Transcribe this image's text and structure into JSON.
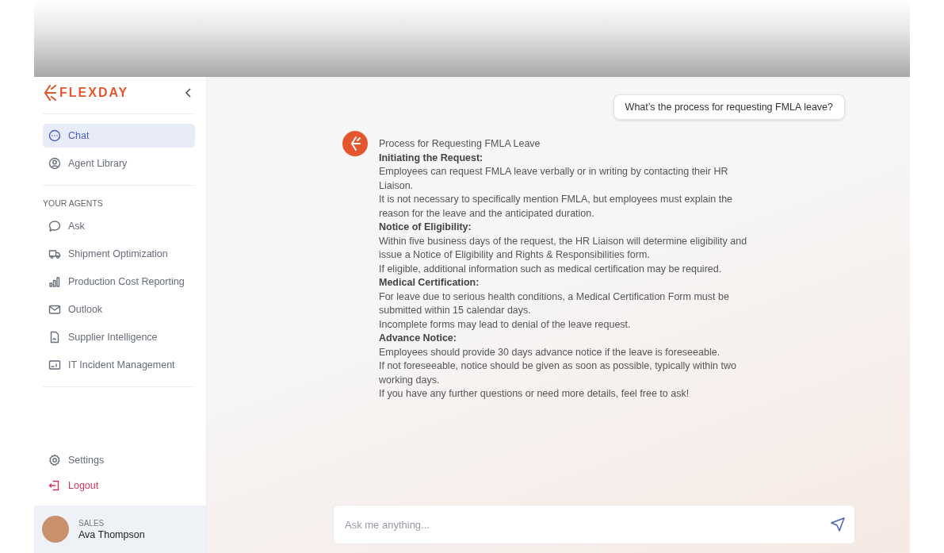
{
  "sidebar": {
    "logo": "FLEXDAY",
    "nav": [
      {
        "label": "Chat",
        "selected": true
      },
      {
        "label": "Agent Library",
        "selected": false
      }
    ],
    "section_label": "YOUR AGENTS",
    "agents": [
      {
        "label": "Ask",
        "selected": false
      },
      {
        "label": "Shipment Optimization",
        "selected": false
      },
      {
        "label": "Production Cost Reporting",
        "selected": false
      },
      {
        "label": "Outlook",
        "selected": false
      },
      {
        "label": "Supplier Intelligence",
        "selected": false
      },
      {
        "label": "IT Incident Management",
        "selected": false
      }
    ],
    "bottom": [
      {
        "label": "Settings",
        "kind": "settings"
      },
      {
        "label": "Logout",
        "kind": "logout"
      }
    ],
    "user": {
      "role": "SALES",
      "name": "Ava Thompson"
    }
  },
  "chat": {
    "user_message": "What’s the process for requesting FMLA leave?",
    "reply": [
      {
        "kind": "title",
        "text": "Process for Requesting FMLA Leave"
      },
      {
        "kind": "heading",
        "text": "Initiating the Request:"
      },
      {
        "kind": "text",
        "text": "Employees can request FMLA leave verbally or in writing by contacting their HR Liaison."
      },
      {
        "kind": "text",
        "text": "It is not necessary to specifically mention FMLA, but employees must explain the reason for the leave and the anticipated duration."
      },
      {
        "kind": "heading",
        "text": "Notice of Eligibility:"
      },
      {
        "kind": "text",
        "text": "Within five business days of the request, the HR Liaison will determine eligibility and issue a Notice of Eligibility and Rights & Responsibilities form."
      },
      {
        "kind": "text",
        "text": "If eligible, additional information such as medical certification may be required."
      },
      {
        "kind": "heading",
        "text": "Medical Certification:"
      },
      {
        "kind": "text",
        "text": "For leave due to serious health conditions, a Medical Certification Form must be submitted within 15 calendar days."
      },
      {
        "kind": "text",
        "text": "Incomplete forms may lead to denial of the leave request."
      },
      {
        "kind": "heading",
        "text": "Advance Notice:"
      },
      {
        "kind": "text",
        "text": "Employees should provide 30 days advance notice if the leave is foreseeable."
      },
      {
        "kind": "text",
        "text": "If not foreseeable, notice should be given as soon as possible, typically within two working days."
      },
      {
        "kind": "text",
        "text": "If you have any further questions or need more details, feel free to ask!"
      }
    ],
    "input": {
      "placeholder": "Ask me anything..."
    }
  }
}
